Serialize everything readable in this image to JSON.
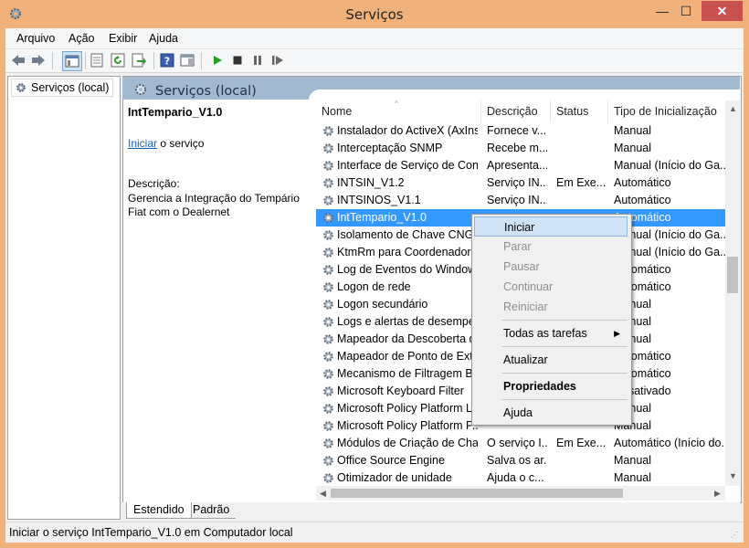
{
  "window": {
    "title": "Serviços",
    "minimize": "—",
    "maximize": "☐",
    "close": "✕"
  },
  "menu": [
    "Arquivo",
    "Ação",
    "Exibir",
    "Ajuda"
  ],
  "tree": {
    "item": "Serviços (local)"
  },
  "pane": {
    "title": "Serviços (local)"
  },
  "description": {
    "service_name": "IntTempario_V1.0",
    "start_link": "Iniciar",
    "start_suffix": " o serviço",
    "label": "Descrição:",
    "text": "Gerencia a Integração do Tempário Fiat com o Dealernet"
  },
  "columns": [
    "Nome",
    "Descrição",
    "Status",
    "Tipo de Inicialização"
  ],
  "rows": [
    {
      "name": "Instalador do ActiveX (AxIns...",
      "desc": "Fornece v...",
      "status": "",
      "startup": "Manual"
    },
    {
      "name": "Interceptação SNMP",
      "desc": "Recebe m...",
      "status": "",
      "startup": "Manual"
    },
    {
      "name": "Interface de Serviço de Con...",
      "desc": "Apresenta...",
      "status": "",
      "startup": "Manual (Início do Ga..."
    },
    {
      "name": "INTSIN_V1.2",
      "desc": "Serviço IN...",
      "status": "Em Exe...",
      "startup": "Automático"
    },
    {
      "name": "INTSINOS_V1.1",
      "desc": "Serviço IN...",
      "status": "",
      "startup": "Automático"
    },
    {
      "name": "IntTempario_V1.0",
      "desc": "",
      "status": "",
      "startup": "Automático"
    },
    {
      "name": "Isolamento de Chave CNG",
      "desc": "",
      "status": "",
      "startup": "Manual (Início do Ga..."
    },
    {
      "name": "KtmRm para Coordenador ...",
      "desc": "",
      "status": "",
      "startup": "Manual (Início do Ga..."
    },
    {
      "name": "Log de Eventos do Windows",
      "desc": "",
      "status": "",
      "startup": "Automático"
    },
    {
      "name": "Logon de rede",
      "desc": "",
      "status": "",
      "startup": "Automático"
    },
    {
      "name": "Logon secundário",
      "desc": "",
      "status": "",
      "startup": "Manual"
    },
    {
      "name": "Logs e alertas de desempen...",
      "desc": "",
      "status": "",
      "startup": "Manual"
    },
    {
      "name": "Mapeador da Descoberta d...",
      "desc": "",
      "status": "",
      "startup": "Manual"
    },
    {
      "name": "Mapeador de Ponto de Extr...",
      "desc": "",
      "status": "",
      "startup": "Automático"
    },
    {
      "name": "Mecanismo de Filtragem Bá...",
      "desc": "",
      "status": "",
      "startup": "Automático"
    },
    {
      "name": "Microsoft Keyboard Filter",
      "desc": "",
      "status": "",
      "startup": "Desativado"
    },
    {
      "name": "Microsoft Policy Platform L...",
      "desc": "",
      "status": "",
      "startup": "Manual"
    },
    {
      "name": "Microsoft Policy Platform P...",
      "desc": "",
      "status": "",
      "startup": "Manual"
    },
    {
      "name": "Módulos de Criação de Cha...",
      "desc": "O serviço I...",
      "status": "Em Exe...",
      "startup": "Automático (Início do..."
    },
    {
      "name": "Office  Source Engine",
      "desc": "Salva os ar...",
      "status": "",
      "startup": "Manual"
    },
    {
      "name": "Otimizador de unidade",
      "desc": "Ajuda o c...",
      "status": "",
      "startup": "Manual"
    }
  ],
  "context_menu": {
    "start": "Iniciar",
    "stop": "Parar",
    "pause": "Pausar",
    "resume": "Continuar",
    "restart": "Reiniciar",
    "all_tasks": "Todas as tarefas",
    "refresh": "Atualizar",
    "properties": "Propriedades",
    "help": "Ajuda"
  },
  "tabs": [
    "Estendido",
    "Padrão"
  ],
  "statusbar": "Iniciar o serviço IntTempario_V1.0 em Computador local",
  "colors": {
    "title_bg": "#f0b27a",
    "close_bg": "#c75050",
    "selection": "#3399ff",
    "pane_header": "#a3b9d0",
    "link": "#1060b0"
  }
}
